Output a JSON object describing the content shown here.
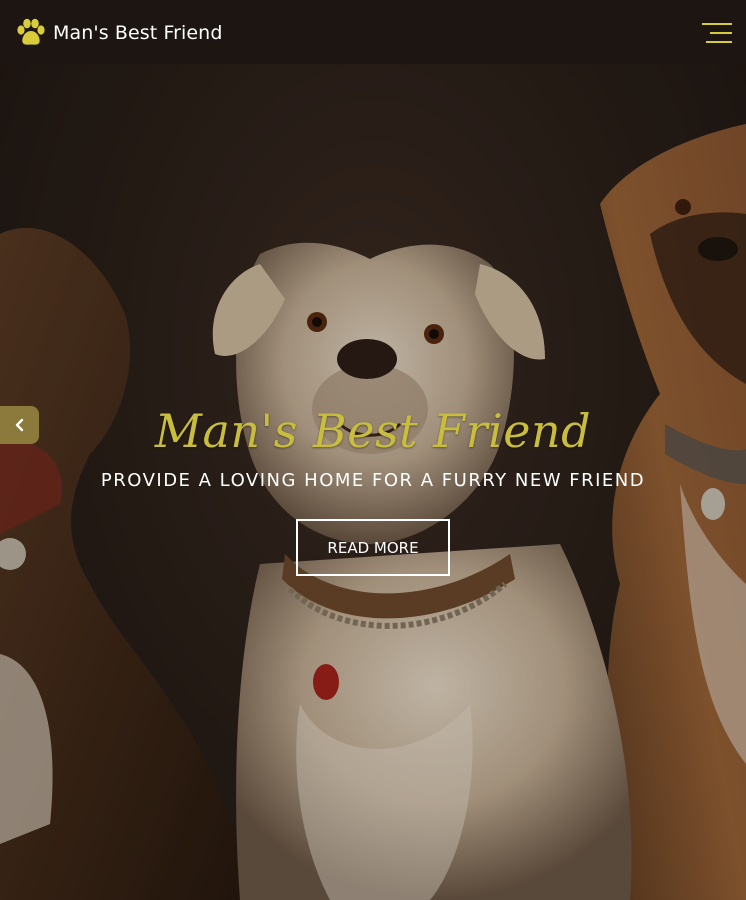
{
  "brand": {
    "name": "Man's Best Friend",
    "icon": "paw-icon",
    "icon_color": "#d9cc3a"
  },
  "nav": {
    "menu_icon": "hamburger-menu-icon",
    "menu_icon_color": "#d9cc3a"
  },
  "hero": {
    "title": "Man's Best Friend",
    "subtitle": "PROVIDE A LOVING HOME FOR A FURRY NEW FRIEND",
    "button_label": "READ MORE",
    "prev_icon": "chevron-left-icon",
    "title_color": "#c8bd3c",
    "arrow_bg_color": "#8c7a3c"
  }
}
